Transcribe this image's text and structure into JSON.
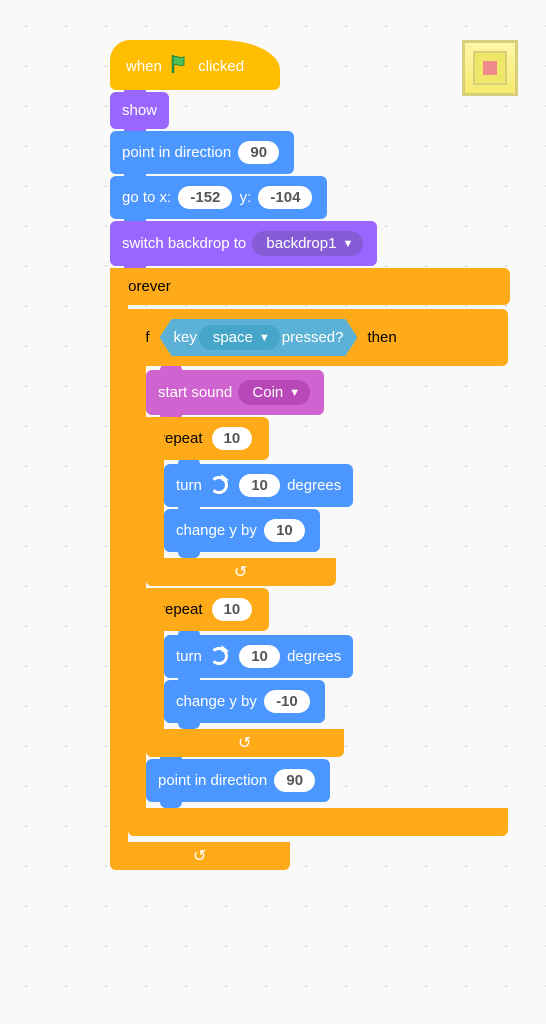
{
  "colors": {
    "events": "#febd00",
    "looks": "#9966ff",
    "motion": "#4c97ff",
    "control": "#ffab19",
    "sound": "#cf63cf",
    "sensing": "#5cb1d6"
  },
  "stop_button": {
    "semantic": "stop-all"
  },
  "hat": {
    "prefix": "when",
    "flag": "green-flag-icon",
    "suffix": "clicked"
  },
  "blocks": {
    "show": "show",
    "point_direction_label": "point in direction",
    "point_direction_value": "90",
    "goto_prefix": "go to x:",
    "goto_x": "-152",
    "goto_y_label": "y:",
    "goto_y": "-104",
    "switch_backdrop_label": "switch backdrop to",
    "switch_backdrop_value": "backdrop1",
    "forever": "forever",
    "if": "if",
    "then": "then",
    "key_prefix": "key",
    "key_value": "space",
    "key_suffix": "pressed?",
    "start_sound_label": "start sound",
    "start_sound_value": "Coin",
    "repeat_label": "repeat",
    "repeat1_count": "10",
    "turn_label": "turn",
    "turn1_deg": "10",
    "degrees": "degrees",
    "change_y_label": "change y by",
    "change_y1_val": "10",
    "repeat2_count": "10",
    "turn2_deg": "10",
    "change_y2_val": "-10",
    "point_direction2_value": "90"
  }
}
